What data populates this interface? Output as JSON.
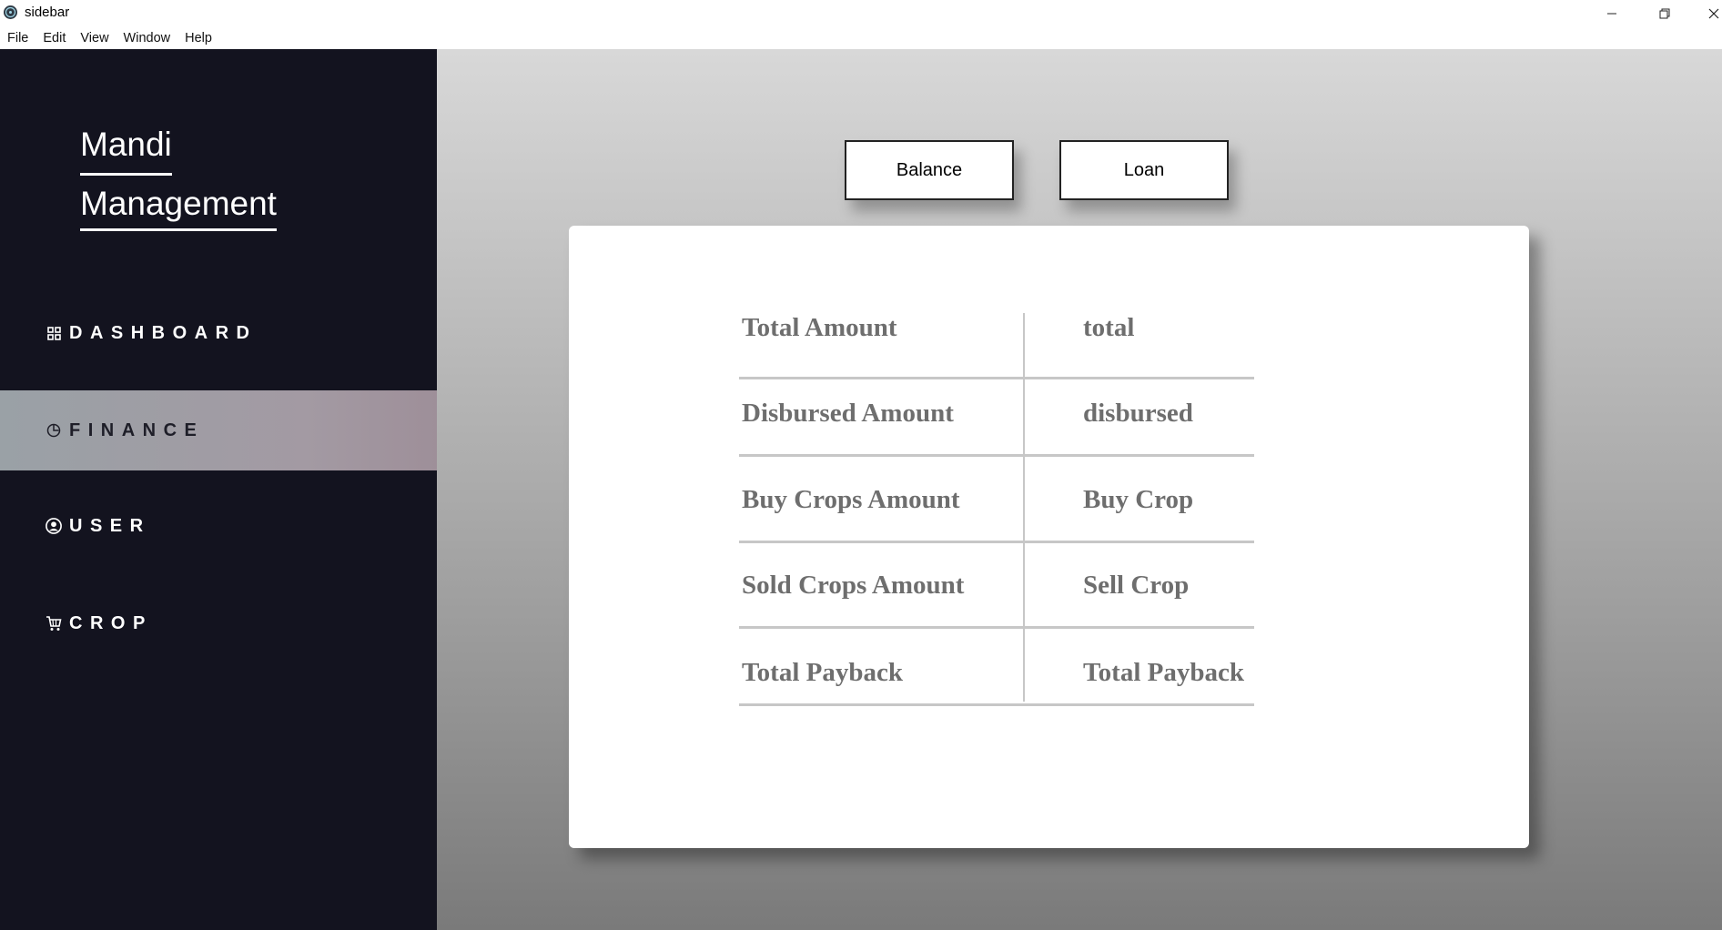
{
  "window": {
    "title": "sidebar"
  },
  "menu": [
    "File",
    "Edit",
    "View",
    "Window",
    "Help"
  ],
  "sidebar": {
    "brand_line1": "Mandi",
    "brand_line2": "Management",
    "items": [
      {
        "label": "DASHBOARD",
        "icon": "grid-icon",
        "active": false
      },
      {
        "label": "FINANCE",
        "icon": "pie-chart-icon",
        "active": true
      },
      {
        "label": "USER",
        "icon": "user-circle-icon",
        "active": false
      },
      {
        "label": "CROP",
        "icon": "cart-icon",
        "active": false
      }
    ]
  },
  "tabs": {
    "balance": "Balance",
    "loan": "Loan"
  },
  "finance_table": [
    {
      "label": "Total Amount",
      "value": "total"
    },
    {
      "label": "Disbursed Amount",
      "value": "disbursed"
    },
    {
      "label": "Buy Crops Amount",
      "value": "Buy Crop"
    },
    {
      "label": "Sold Crops Amount",
      "value": "Sell Crop"
    },
    {
      "label": "Total Payback",
      "value": "Total Payback"
    }
  ],
  "colors": {
    "sidebar_bg": "#13131f",
    "active_item_bg": "#a39aa3",
    "table_text": "#6e6e6e"
  }
}
